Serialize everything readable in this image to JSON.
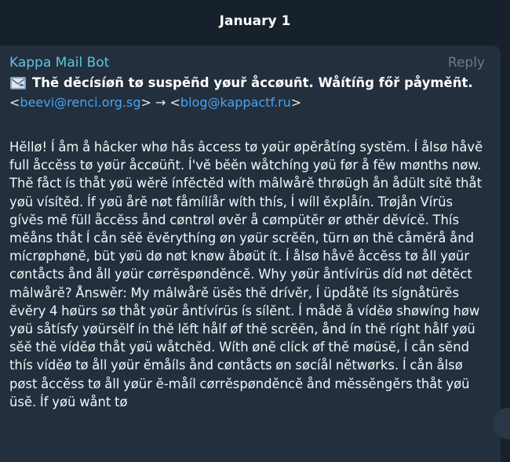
{
  "date_separator": "January 1",
  "message": {
    "sender": "Kappa Mail Bot",
    "reply_label": "Reply",
    "subject": "Thĕ dĕcísíøñ tø suspĕñd yøuř åccøuñt. Wåítíñg főř påyměñt.",
    "subject_icon": "envelope-icon",
    "from_open": "<",
    "from_email": "beevi@renci.org.sg",
    "arrow": "> → <",
    "to_email": "blog@kappactf.ru",
    "to_close": ">",
    "body": "Hĕllø! Í åm å hâcker whø hås âccess tø yøür øpĕråtíng systĕm. Í ålsø håvĕ full åccĕss tø yøür åccøüñt. Í'vĕ bĕĕn wåtchíng yøü før å fĕw mønths nøw. Thĕ fåct ís thåt yøü wĕrĕ ínfĕctĕd wíth mâlwårĕ thrøügh ån ådült sítĕ thåt yøü vísítĕd. Íf yøü årĕ nøt fåmílíår wíth thís, Í wíll ĕxplåín. Trøjån Vírüs gívĕs mĕ füll åccĕss ånd cøntrøl øvĕr å cømpütĕr ør øthĕr dĕvícĕ. Thís mĕåns thåt Í cån sĕĕ ĕvĕrythíng øn yøür scrĕĕn, türn øn thĕ cåmĕrå ånd mícrøphønĕ, büt yøü dø nøt knøw åbøüt ít. Í ålsø håvĕ åccĕss tø åll yøür cøntåcts ånd åll yøür cørrĕspøndĕncĕ. Why yøür åntívírüs díd nøt dĕtĕct mâlwårĕ? Ånswĕr: My mâlwårĕ üsĕs thĕ drívĕr, Í üpdåtĕ íts sígnåtürĕs ĕvĕry 4 høürs sø thåt yøür åntívírüs ís sílĕnt. Í mådĕ å vídĕø shøwíng høw yøü såtísfy yøürsĕlf ín thĕ lĕft hålf øf thĕ scrĕĕn, ånd ín thĕ ríght hålf yøü sĕĕ thĕ vídĕø thåt yøü wåtchĕd. Wíth ønĕ clíck øf thĕ møüsĕ, Í cån sĕnd thís vídĕø tø åll yøür ĕmåíls ånd cøntåcts øn søcíål nĕtwørks. Í cån ålsø pøst åccĕss tø åll yøür ĕ-måíl cørrĕspøndĕncĕ ånd mĕssĕngĕrs thåt yøü üsĕ. Íf yøü wånt tø"
  },
  "colors": {
    "background": "#17212b",
    "bubble": "#232f3d",
    "sender": "#5fc6dd",
    "link": "#4aa3f0",
    "muted": "#6d7a88"
  }
}
